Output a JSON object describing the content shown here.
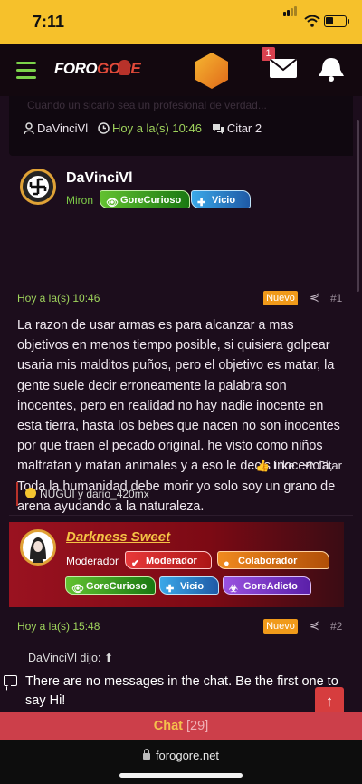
{
  "status_bar": {
    "time": "7:11"
  },
  "navbar": {
    "logo_text_1": "FORO",
    "logo_text_2": "GORE",
    "mail_badge": "1",
    "colors": {
      "accent_green": "#7bd24a",
      "hex_orange": "#f0a02a",
      "badge_red": "#d9414f"
    }
  },
  "quoted_post": {
    "faded_text": "Cuando un sicario sea un profesional de verdad...",
    "author": "DaVinciVl",
    "time": "Hoy a la(s) 10:46",
    "quote_label": "Citar 2"
  },
  "post1": {
    "author": "DaVinciVl",
    "role": "Miron",
    "badges": [
      {
        "label": "GoreCurioso",
        "icon": "eye-icon",
        "color": "#4fae25"
      },
      {
        "label": "Vicio",
        "icon": "syringe-icon",
        "color": "#2f8ed0"
      }
    ],
    "time": "Hoy a la(s) 10:46",
    "new_label": "Nuevo",
    "number": "#1",
    "body": "La razon de usar armas es para alcanzar a mas objetivos en menos tiempo posible, si quisiera golpear usaria mis malditos puños, pero el objetivo es matar, la gente suele decir erroneamente la palabra son inocentes, pero en realidad no hay nadie inocente en esta tierra, hasta los bebes que nacen no son inocentes por que traen el pecado original. he visto como niños maltratan y matan animales y a eso le decis inocencia, Toda la humanidad debe morir yo solo soy un grano de arena ayudando a la naturaleza.",
    "like_label": "Like",
    "quote_label": "Citar",
    "reactions": "NUGUI y dario_420mx"
  },
  "post2": {
    "author": "Darkness Sweet",
    "role": "Moderador",
    "badges": [
      {
        "label": "Moderador",
        "icon": "check-icon",
        "color": "#d92d2d"
      },
      {
        "label": "Colaborador",
        "icon": "grenade-icon",
        "color": "#e67e17"
      },
      {
        "label": "GoreCurioso",
        "icon": "eye-icon",
        "color": "#4fae25"
      },
      {
        "label": "Vicio",
        "icon": "syringe-icon",
        "color": "#2f8ed0"
      },
      {
        "label": "GoreAdicto",
        "icon": "biohazard-icon",
        "color": "#8a3fd6"
      }
    ],
    "time": "Hoy a la(s) 15:48",
    "new_label": "Nuevo",
    "number": "#2",
    "quote_title": "DaVinciVl dijo:"
  },
  "chat": {
    "message": "There are no messages in the chat. Be the first one to say Hi!",
    "bar_label": "Chat",
    "bar_count": "[29]"
  },
  "browser": {
    "url": "forogore.net"
  }
}
